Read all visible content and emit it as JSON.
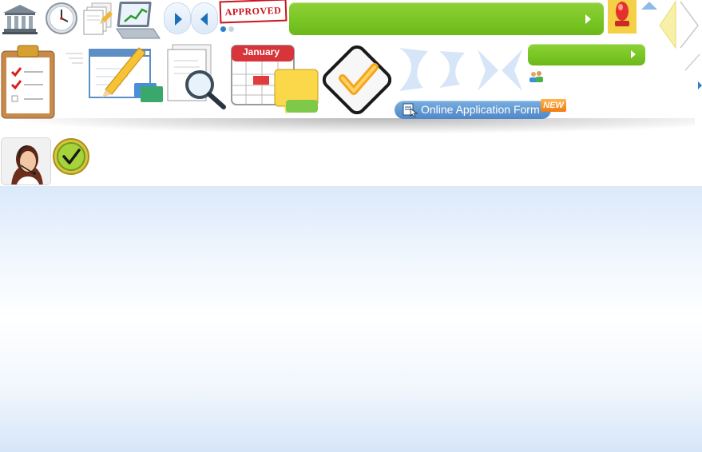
{
  "top_row": {
    "icons": [
      "bank-icon",
      "clock-icon",
      "documents-icon",
      "laptop-chart-icon"
    ],
    "stamp_text": "APPROVED",
    "big_green_button_label": "",
    "pager_active_dot": 1,
    "pager_dots": 2
  },
  "banner": {
    "icons": [
      "clipboard-checklist-icon",
      "pencil-form-icon",
      "magnifier-document-icon",
      "calendar-chat-icon",
      "checkmark-icon",
      "arrows-process-icon"
    ],
    "calendar_month": "January",
    "small_green_button_label": "",
    "online_form_label": "Online Application Form",
    "new_badge": "NEW"
  },
  "support": {
    "icons": [
      "support-agent-avatar",
      "verified-badge-icon"
    ]
  },
  "colors": {
    "green": "#7bc725",
    "blue_button": "#4f87c7",
    "stamp_red": "#c9141c",
    "nav_blue": "#1d6fb8"
  }
}
